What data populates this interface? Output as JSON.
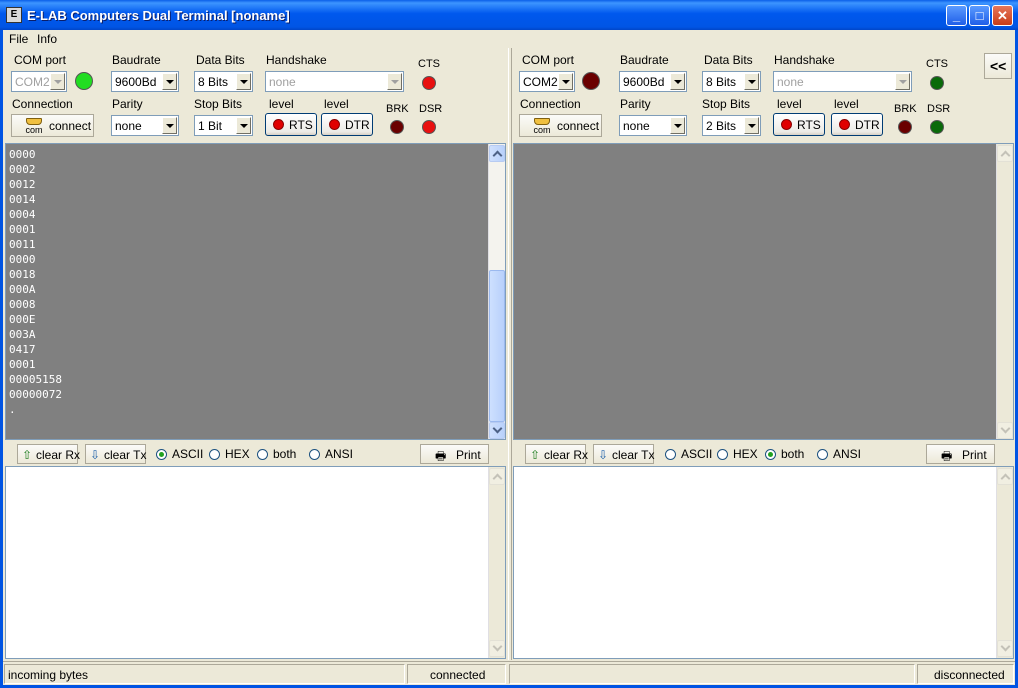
{
  "window": {
    "title": "E-LAB Computers Dual Terminal [noname]",
    "icon_label": "E"
  },
  "menu": [
    "File",
    "Info"
  ],
  "labels": {
    "com_port": "COM port",
    "baudrate": "Baudrate",
    "data_bits": "Data Bits",
    "handshake": "Handshake",
    "cts": "CTS",
    "connection": "Connection",
    "parity": "Parity",
    "stop_bits": "Stop Bits",
    "level": "level",
    "brk": "BRK",
    "dsr": "DSR",
    "connect_button": "connect",
    "com_icon_text": "com",
    "rts_button": "RTS",
    "dtr_button": "DTR",
    "clear_rx": "clear Rx",
    "clear_tx": "clear Tx",
    "ascii": "ASCII",
    "hex": "HEX",
    "both": "both",
    "ansi": "ANSI",
    "print": "Print",
    "collapse": "<<"
  },
  "left": {
    "com_port": "COM2",
    "baudrate": "9600Bd",
    "data_bits": "8 Bits",
    "handshake": "none",
    "parity": "none",
    "stop_bits": "1 Bit",
    "display_mode": "ascii",
    "rx_lines": [
      "0000",
      "0002",
      "0012",
      "0014",
      "0004",
      "0001",
      "0011",
      "0000",
      "0018",
      "000A",
      "0008",
      "000E",
      "003A",
      "0417",
      "0001",
      "00005158",
      "00000072",
      "."
    ],
    "status_left": "incoming bytes",
    "status_right": "connected"
  },
  "right": {
    "com_port": "COM2",
    "baudrate": "9600Bd",
    "data_bits": "8 Bits",
    "handshake": "none",
    "parity": "none",
    "stop_bits": "2 Bits",
    "display_mode": "both",
    "status_left": "",
    "status_right": "disconnected"
  },
  "colors": {
    "led_green": "#22dd22",
    "led_red": "#e81010",
    "led_dark_red": "#6a0000",
    "led_dark_green": "#0a6a0a",
    "rx_background": "#808080"
  }
}
